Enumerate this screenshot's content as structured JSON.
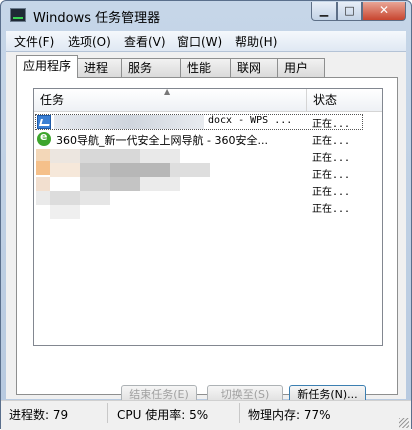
{
  "window": {
    "title": "Windows 任务管理器"
  },
  "menu": [
    "文件(F)",
    "选项(O)",
    "查看(V)",
    "窗口(W)",
    "帮助(H)"
  ],
  "tabs": [
    "应用程序",
    "进程",
    "服务",
    "性能",
    "联网",
    "用户"
  ],
  "list": {
    "columns": {
      "task": "任务",
      "status": "状态"
    },
    "rows": [
      {
        "task": "docx - WPS ...",
        "status": "正在...",
        "icon": "wps-writer-icon"
      },
      {
        "task": "360导航_新一代安全上网导航 - 360安全...",
        "status": "正在...",
        "icon": "browser-ie-icon"
      },
      {
        "task": "",
        "status": "正在..."
      },
      {
        "task": "",
        "status": "正在..."
      },
      {
        "task": "",
        "status": "正在..."
      },
      {
        "task": "",
        "status": "正在..."
      }
    ]
  },
  "buttons": {
    "end_task": "结束任务(E)",
    "switch_to": "切换至(S)",
    "new_task": "新任务(N)..."
  },
  "statusbar": {
    "processes": "进程数: 79",
    "cpu": "CPU 使用率: 5%",
    "memory": "物理内存: 77%"
  },
  "colors": {
    "title_bg": "#c6d6e8",
    "close_button": "#c8452f",
    "selection_border": "#555555"
  }
}
